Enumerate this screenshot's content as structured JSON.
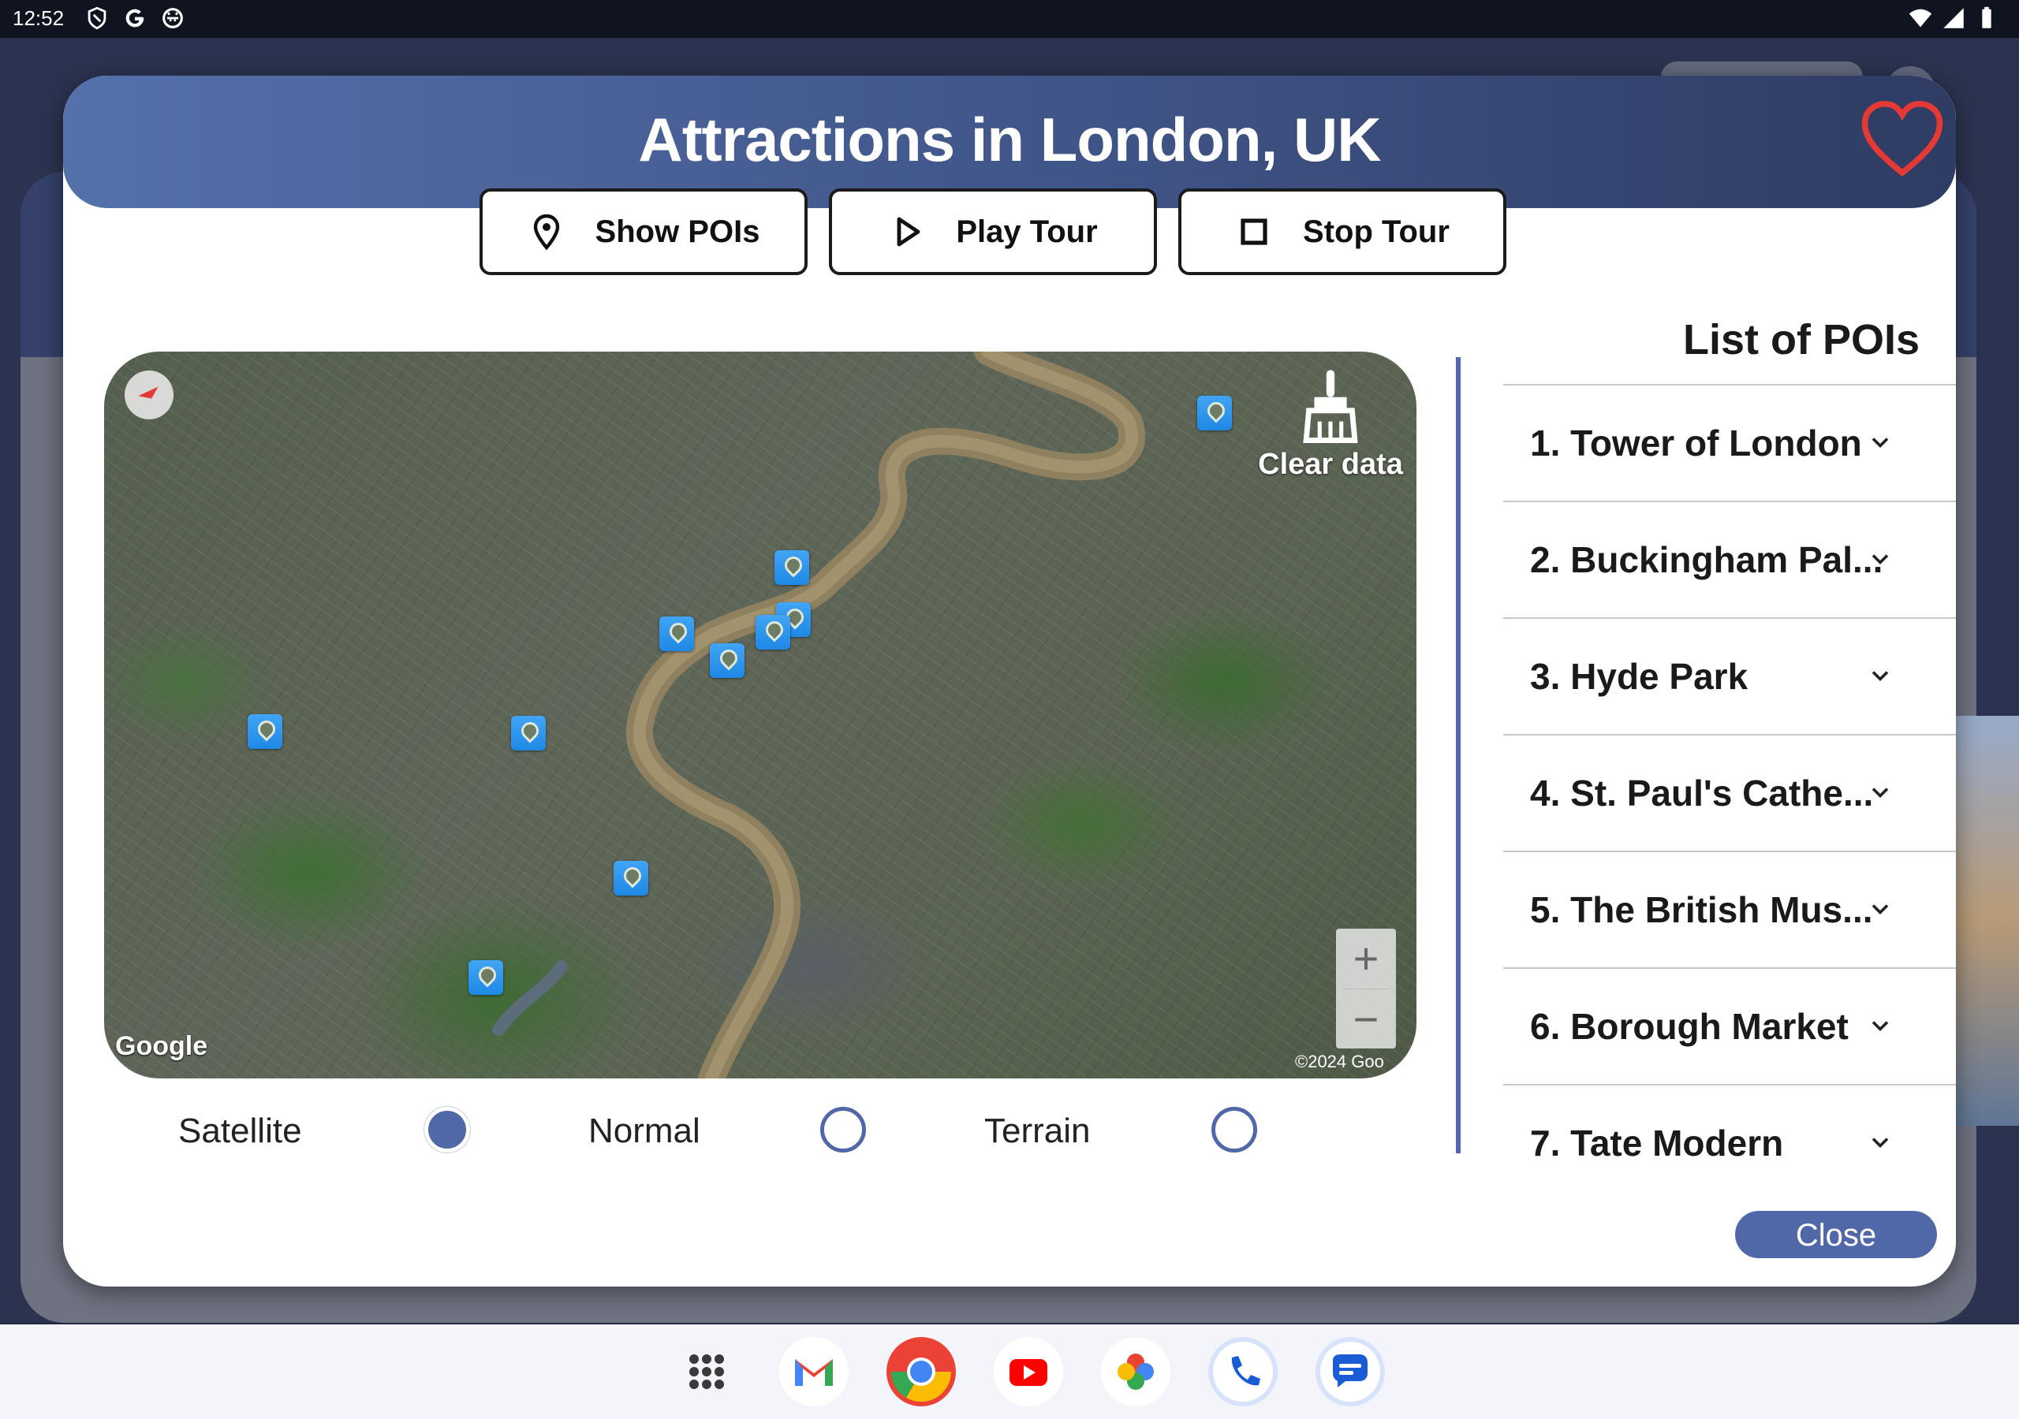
{
  "status_bar": {
    "time": "12:52",
    "left_icons": [
      "shield-icon",
      "google-g-icon",
      "android-icon"
    ],
    "right_icons": [
      "wifi-icon",
      "cell-signal-icon",
      "battery-icon"
    ]
  },
  "dialog": {
    "title": "Attractions in London, UK",
    "favorite_icon": "heart-outline-icon",
    "accent_color": "#5068a8",
    "favorite_color": "#e53935",
    "buttons": {
      "show_pois": "Show POIs",
      "play_tour": "Play Tour",
      "stop_tour": "Stop Tour"
    },
    "map": {
      "clear_data_label": "Clear data",
      "zoom_in": "+",
      "zoom_out": "−",
      "logo": "Google",
      "copyright": "©2024 Goo"
    },
    "map_types": [
      {
        "label": "Satellite",
        "selected": true
      },
      {
        "label": "Normal",
        "selected": false
      },
      {
        "label": "Terrain",
        "selected": false
      }
    ],
    "poi_list": {
      "title": "List of POIs",
      "items": [
        "1. Tower of London",
        "2. Buckingham Pal...",
        "3. Hyde Park",
        "4. St. Paul's Cathe...",
        "5. The British Mus...",
        "6. Borough Market",
        "7. Tate Modern"
      ]
    },
    "close_label": "Close"
  },
  "dock": {
    "apps": [
      "app-drawer-icon",
      "gmail-icon",
      "chrome-icon",
      "youtube-icon",
      "photos-icon",
      "phone-icon",
      "messages-icon"
    ]
  }
}
